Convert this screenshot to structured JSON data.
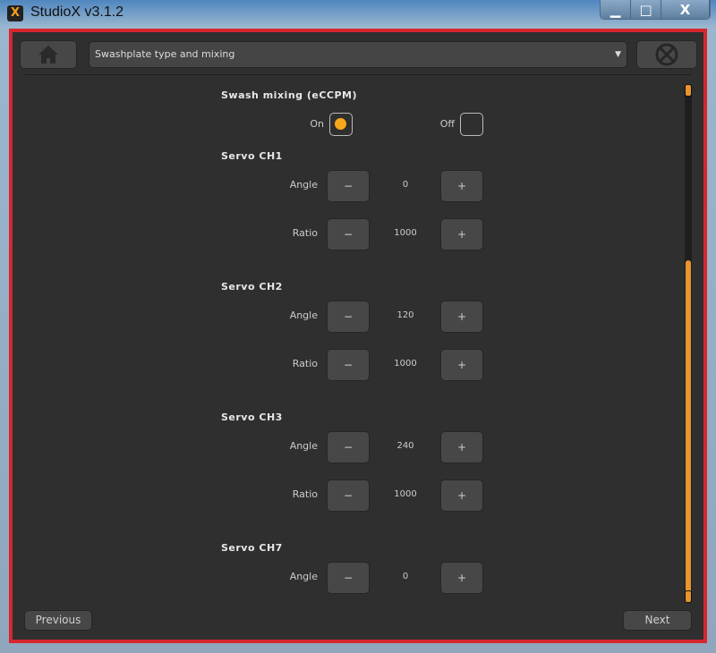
{
  "window": {
    "title": "StudioX v3.1.2",
    "icon": "X",
    "minimize": "▁",
    "maximize": "□",
    "close": "X"
  },
  "toolbar": {
    "home_icon": "home-icon",
    "page_select": "Swashplate type and mixing",
    "stop_icon": "no-heli-icon"
  },
  "mixing": {
    "heading": "Swash mixing (eCCPM)",
    "on_label": "On",
    "off_label": "Off",
    "selected": "On",
    "accent": "#f7a81b"
  },
  "servos": [
    {
      "heading": "Servo CH1",
      "rows": [
        {
          "label": "Angle",
          "value": "0"
        },
        {
          "label": "Ratio",
          "value": "1000"
        }
      ]
    },
    {
      "heading": "Servo CH2",
      "rows": [
        {
          "label": "Angle",
          "value": "120"
        },
        {
          "label": "Ratio",
          "value": "1000"
        }
      ]
    },
    {
      "heading": "Servo CH3",
      "rows": [
        {
          "label": "Angle",
          "value": "240"
        },
        {
          "label": "Ratio",
          "value": "1000"
        }
      ]
    },
    {
      "heading": "Servo CH7",
      "rows": [
        {
          "label": "Angle",
          "value": "0"
        }
      ]
    }
  ],
  "stepper": {
    "minus": "−",
    "plus": "+"
  },
  "scroll": {
    "position_fraction": 0.33,
    "visible_fraction": 0.68
  },
  "footer": {
    "previous": "Previous",
    "next": "Next"
  }
}
